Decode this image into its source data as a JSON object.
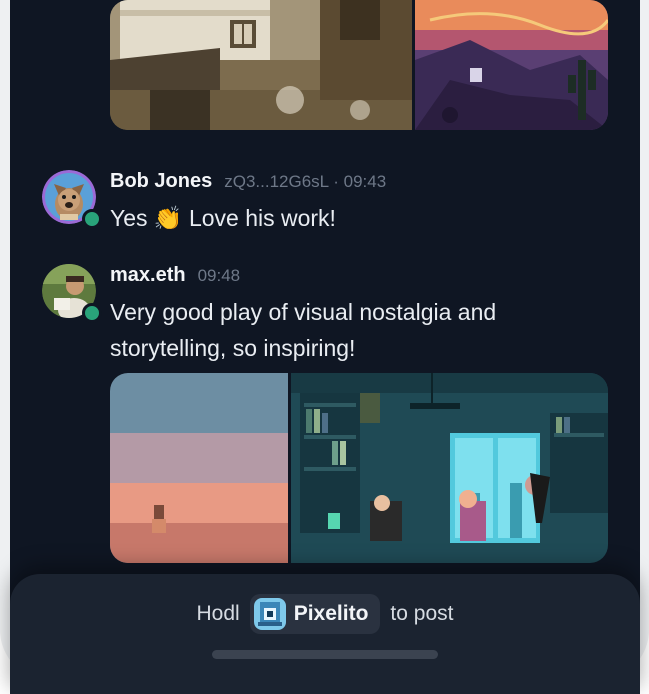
{
  "messages": [
    {
      "author": "Bob Jones",
      "meta": "zQ3...12G6sL · 09:43",
      "text": "Yes 👏 Love his work!",
      "avatar": "dog-avatar"
    },
    {
      "author": "max.eth",
      "meta": "09:48",
      "text": "Very good play of visual nostalgia and storytelling, so inspiring!",
      "avatar": "person-avatar"
    }
  ],
  "post_bar": {
    "prefix": "Hodl",
    "token_name": "Pixelito",
    "suffix": "to post"
  },
  "colors": {
    "background": "#0f1623",
    "online": "#29a37a",
    "bar": "#1b2330"
  }
}
